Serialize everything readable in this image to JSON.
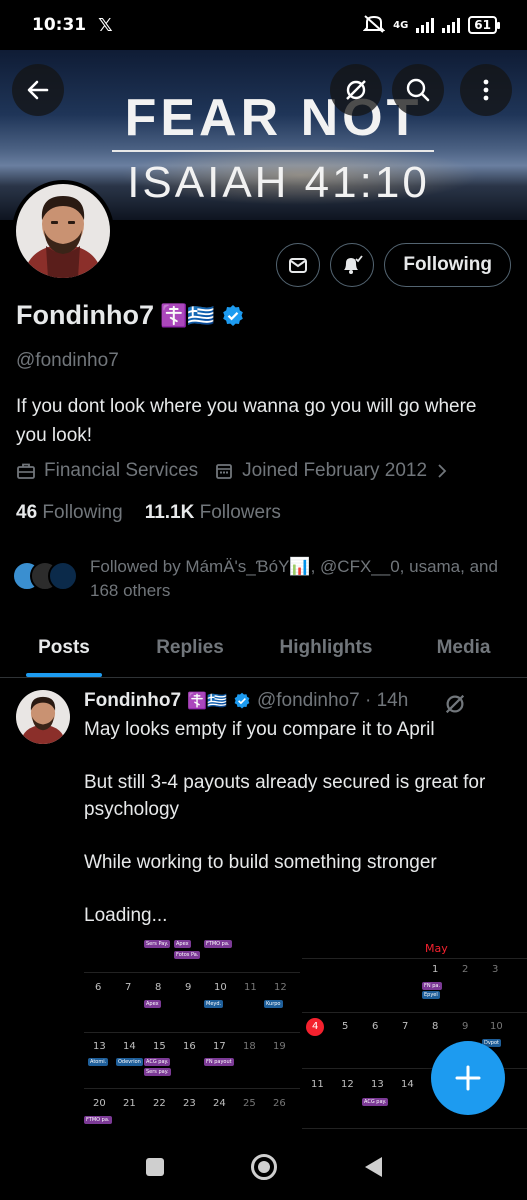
{
  "status_bar": {
    "time": "10:31",
    "network": "4G",
    "battery": "61"
  },
  "header": {
    "back_icon": "arrow-left-icon",
    "grok_icon": "grok-icon",
    "search_icon": "search-icon",
    "more_icon": "more-vertical-icon",
    "banner_line1": "FEAR NOT",
    "banner_line2": "ISAIAH 41:10"
  },
  "profile": {
    "name": "Fondinho7",
    "emoji": "☦️🇬🇷",
    "handle": "@fondinho7",
    "bio": "If you dont look where you wanna go you will go where you look!",
    "category": "Financial Services",
    "joined": "Joined February 2012",
    "following_count": "46",
    "following_label": "Following",
    "followers_count": "11.1K",
    "followers_label": "Followers",
    "follow_button": "Following",
    "followed_by": "Followed by MámÄ's_ƁóY📊, @CFX__0, usama, and 168 others"
  },
  "tabs": [
    {
      "label": "Posts"
    },
    {
      "label": "Replies"
    },
    {
      "label": "Highlights"
    },
    {
      "label": "Media"
    }
  ],
  "post": {
    "author": "Fondinho7",
    "emoji": "☦️🇬🇷",
    "handle_time": "@fondinho7 · 14h",
    "paragraphs": [
      "May looks empty if you compare it to April",
      "But still 3-4 payouts already secured is great for psychology",
      "While working to build something stronger",
      "Loading..."
    ]
  },
  "calendar_left": {
    "row1": [
      "6",
      "7",
      "8",
      "9",
      "10",
      "11",
      "12"
    ],
    "row2": [
      "13",
      "14",
      "15",
      "16",
      "17",
      "18",
      "19"
    ],
    "row3": [
      "20",
      "21",
      "22",
      "23",
      "24",
      "25",
      "26"
    ],
    "pills": [
      "Sers Pay.",
      "Apex",
      "FTMO pa.",
      "Fotos Pa.",
      "Apex",
      "Meyd.",
      "Kurpo",
      "Atomi.",
      "Odevrion",
      "ACG pay.",
      "FN payout",
      "Sers pay.",
      "FTMO pa."
    ]
  },
  "calendar_right": {
    "month": "May",
    "row0": [
      "1",
      "2",
      "3"
    ],
    "row1": [
      "4",
      "5",
      "6",
      "7",
      "8",
      "9",
      "10"
    ],
    "row2": [
      "11",
      "12",
      "13",
      "14"
    ],
    "pills": [
      "FN pa.",
      "Epyel",
      "Dvpot",
      "ACG pay."
    ]
  },
  "colors": {
    "accent": "#1d9bf0",
    "background": "#000000",
    "text": "#e7e9ea",
    "muted": "#71767b",
    "verified": "#1d9bf0",
    "today_marker": "#f4212e"
  }
}
